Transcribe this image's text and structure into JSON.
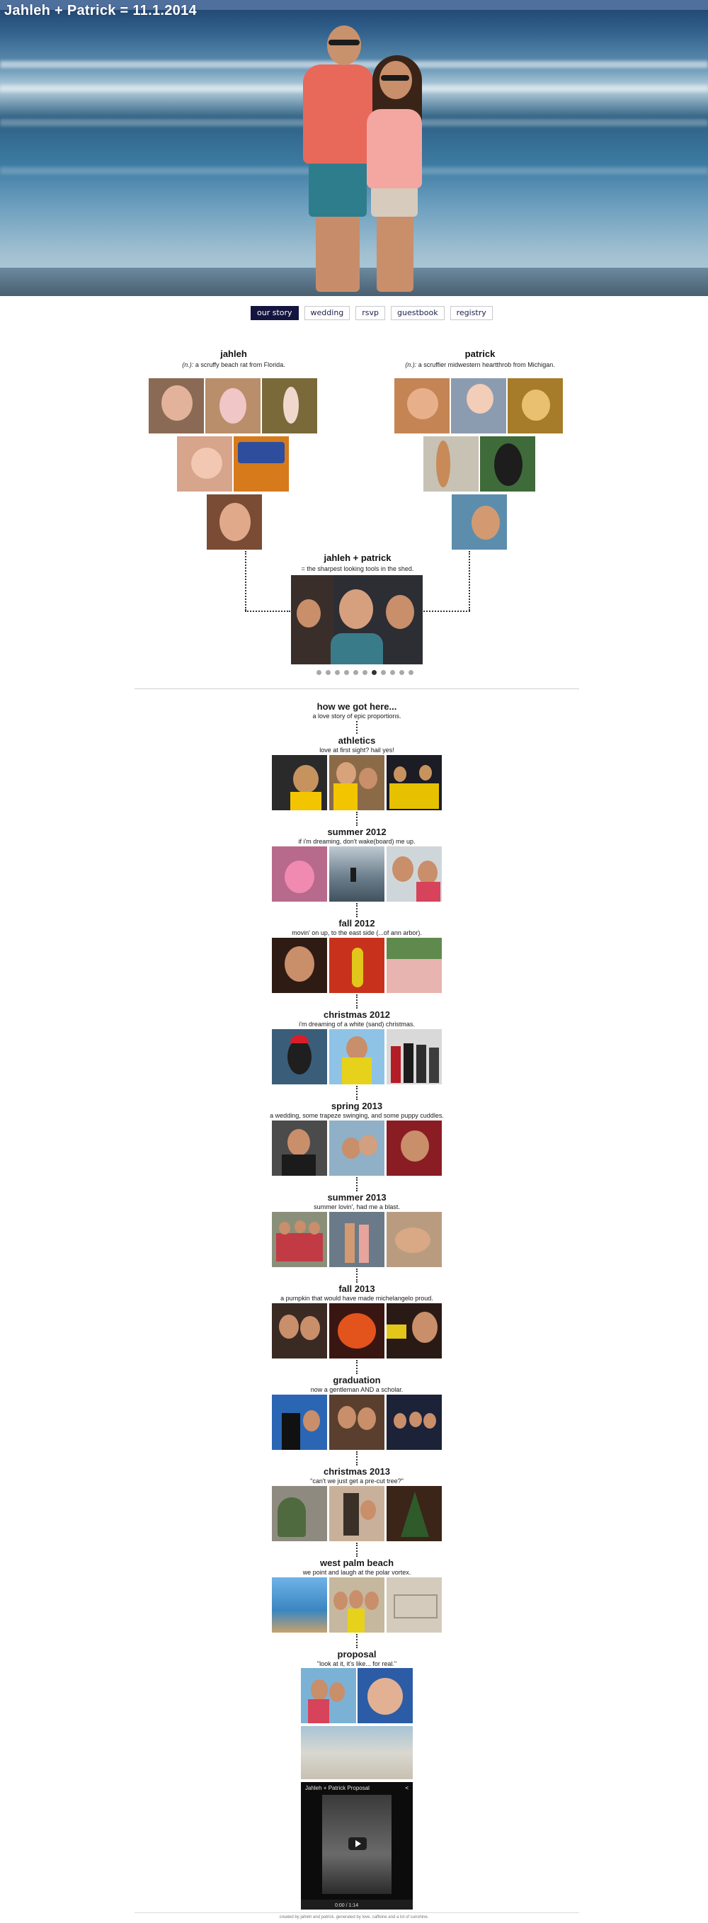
{
  "site_title": "Jahleh + Patrick = 11.1.2014",
  "nav": [
    "our story",
    "wedding",
    "rsvp",
    "guestbook",
    "registry"
  ],
  "nav_active": "our story",
  "jahleh": {
    "name": "jahleh",
    "def_prefix": "(n.):",
    "def_text": "a scruffy beach rat from Florida."
  },
  "patrick": {
    "name": "patrick",
    "def_prefix": "(n.):",
    "def_text": "a scruffier midwestern heartthrob from Michigan."
  },
  "together": {
    "name": "jahleh + patrick",
    "def_text": "= the sharpest looking tools in the shed."
  },
  "carousel": {
    "count": 11,
    "active_index": 6
  },
  "timeline_intro": {
    "title": "how we got here...",
    "subtitle": "a love story of epic proportions."
  },
  "timeline": [
    {
      "title": "athletics",
      "subtitle": "love at first sight? hail yes!"
    },
    {
      "title": "summer 2012",
      "subtitle": "if i'm dreaming, don't wake(board) me up."
    },
    {
      "title": "fall 2012",
      "subtitle": "movin' on up, to the east side (...of ann arbor)."
    },
    {
      "title": "christmas 2012",
      "subtitle": "i'm dreaming of a white (sand) christmas."
    },
    {
      "title": "spring 2013",
      "subtitle": "a wedding, some trapeze swinging, and some puppy cuddles."
    },
    {
      "title": "summer 2013",
      "subtitle": "summer lovin', had me a blast."
    },
    {
      "title": "fall 2013",
      "subtitle": "a pumpkin that would have made michelangelo proud."
    },
    {
      "title": "graduation",
      "subtitle": "now a gentleman AND a scholar."
    },
    {
      "title": "christmas 2013",
      "subtitle": "\"can't we just get a pre-cut tree?\""
    },
    {
      "title": "west palm beach",
      "subtitle": "we point and laugh at the polar vortex."
    },
    {
      "title": "proposal",
      "subtitle": "\"look at it, it's like... for real.\""
    }
  ],
  "video": {
    "title": "Jahleh + Patrick Proposal",
    "time": "0:00 / 1:14"
  },
  "icons": {
    "play": "play-icon",
    "share": "share-icon"
  },
  "colors": {
    "nav_active_bg": "#13143f",
    "accent_text": "#1b1f4f"
  },
  "footer": "created by jahleh and patrick. generated by love, caffeine and a lot of sunshine."
}
